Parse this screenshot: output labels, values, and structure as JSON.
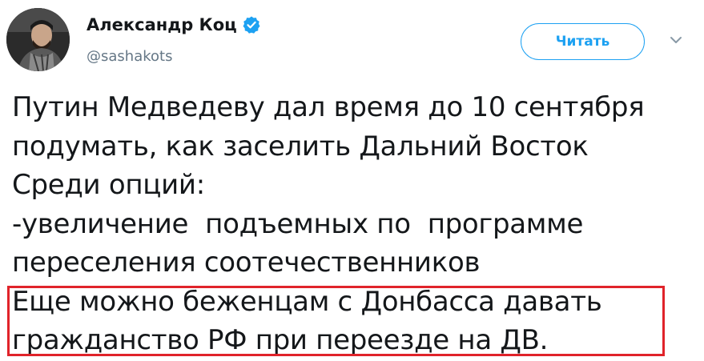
{
  "author": {
    "display_name": "Александр Коц",
    "handle": "@sashakots",
    "verified": true,
    "verified_icon": "verified-badge-icon"
  },
  "actions": {
    "follow_label": "Читать",
    "more_icon": "chevron-down-icon"
  },
  "tweet": {
    "lines": [
      "Путин Медведеву дал время до 10 сентября",
      "подумать, как заселить Дальний Восток",
      "Среди опций:",
      "-увеличение  подъемных по  программе",
      "переселения соотечественников",
      "Еще можно беженцам с Донбасса давать",
      "гражданство РФ при переезде на ДВ."
    ]
  },
  "colors": {
    "accent": "#1da1f2",
    "highlight": "#e0232a",
    "text": "#14171a",
    "muted": "#657786"
  }
}
